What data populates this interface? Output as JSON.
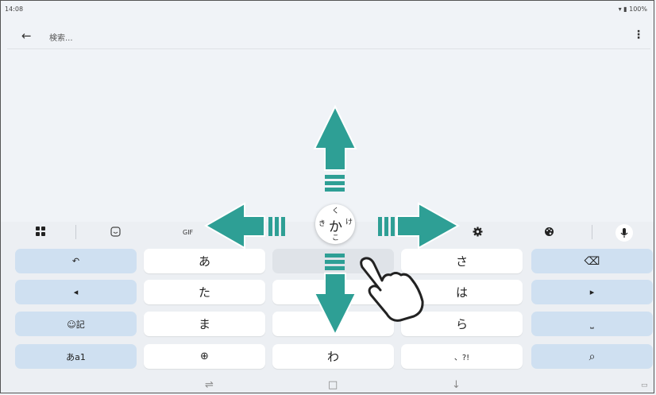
{
  "statusbar": {
    "time": "14:08",
    "battery": "100%"
  },
  "search": {
    "placeholder": "検索..."
  },
  "icons": {
    "back": "arrow-left-icon",
    "more": "more-vert-icon",
    "apps": "apps-grid-icon",
    "sticker": "sticker-icon",
    "settings": "gear-icon",
    "palette": "palette-icon",
    "mic": "mic-icon",
    "wifi": "wifi-icon",
    "battery": "battery-icon"
  },
  "toolbar": {
    "gif_label": "GIF"
  },
  "keyboard": {
    "rows": [
      {
        "left_label": "↶",
        "keys": [
          "あ",
          "",
          "さ"
        ],
        "right_label": "⌫"
      },
      {
        "left_label": "◂",
        "keys": [
          "た",
          "",
          "は"
        ],
        "right_label": "▸"
      },
      {
        "left_label": "☺記",
        "keys": [
          "ま",
          "",
          "ら"
        ],
        "right_label": "⎵"
      },
      {
        "left_label": "あa1",
        "keys": [
          "⊕",
          "わ",
          "、?!"
        ],
        "right_label": "⌕"
      }
    ]
  },
  "flick_popup": {
    "center": "か",
    "up": "く",
    "left": "き",
    "right": "け",
    "down": "こ"
  },
  "colors": {
    "accent": "#2e9f95",
    "hand_stroke": "#222222",
    "blue_key": "#cfe0f1"
  }
}
